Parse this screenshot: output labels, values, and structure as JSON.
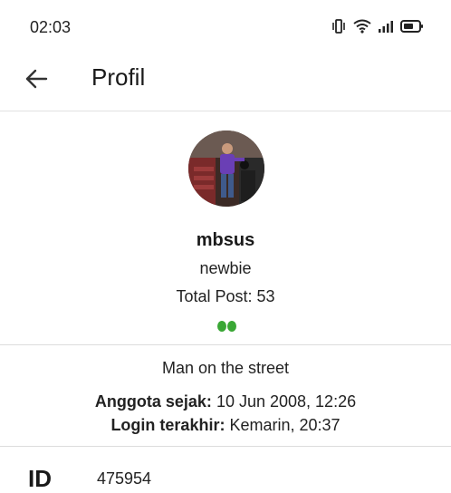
{
  "status_bar": {
    "time": "02:03"
  },
  "app_bar": {
    "title": "Profil",
    "back_icon": "arrow-left-icon"
  },
  "profile": {
    "username": "mbsus",
    "rank": "newbie",
    "total_post": "Total Post: 53",
    "reputation_dots": 2,
    "reputation_color": "#3aa735",
    "user_title": "Man on the street",
    "member_since_label": "Anggota sejak:",
    "member_since_value": "10 Jun 2008, 12:26",
    "last_login_label": "Login terakhir:",
    "last_login_value": "Kemarin, 20:37",
    "id_label": "ID",
    "id_value": "475954"
  }
}
